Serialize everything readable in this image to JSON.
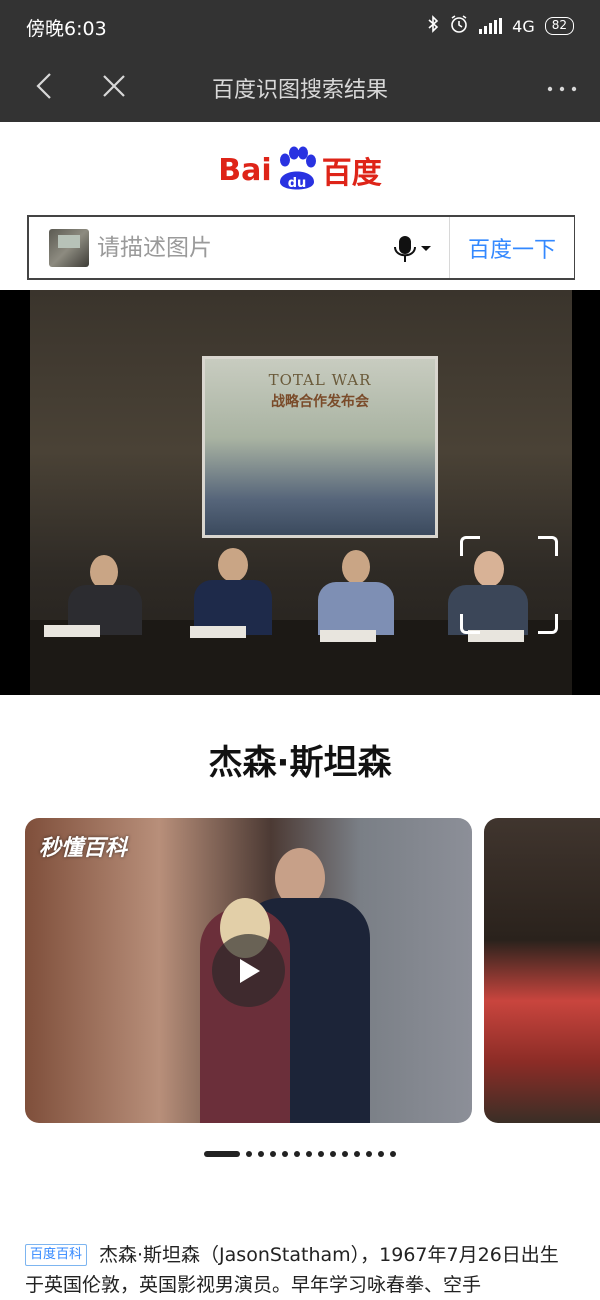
{
  "status_bar": {
    "time": "傍晚6:03",
    "network": "4G",
    "battery": "82"
  },
  "nav": {
    "title": "百度识图搜索结果",
    "back_icon": "chevron-left-icon",
    "close_icon": "close-icon",
    "more_icon": "more-horizontal-icon"
  },
  "logo": {
    "left": "Bai",
    "paw": "du",
    "right": "百度",
    "color": "#de2418"
  },
  "search": {
    "placeholder": "请描述图片",
    "button_label": "百度一下",
    "button_color": "#3388ff"
  },
  "photo": {
    "screen_title": "TOTAL WAR",
    "screen_subtitle": "战略合作发布会"
  },
  "result": {
    "title": "杰森·斯坦森"
  },
  "carousel": {
    "brand": "秒懂百科",
    "play_icon": "play-icon",
    "page_count": 14,
    "active_index": 0
  },
  "description": {
    "source": "百度百科",
    "text": "杰森·斯坦森（JasonStatham），1967年7月26日出生于英国伦敦，英国影视男演员。早年学习咏春拳、空手"
  }
}
